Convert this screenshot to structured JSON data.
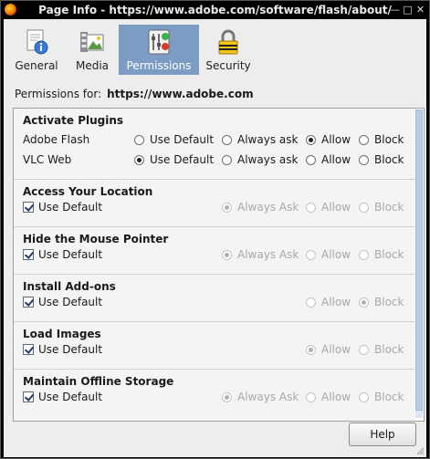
{
  "window": {
    "title": "Page Info - https://www.adobe.com/software/flash/about/"
  },
  "tabs": [
    {
      "label": "General",
      "icon": "general-page-icon"
    },
    {
      "label": "Media",
      "icon": "media-icon"
    },
    {
      "label": "Permissions",
      "icon": "permissions-icon",
      "active": true
    },
    {
      "label": "Security",
      "icon": "padlock-icon"
    }
  ],
  "permissions_for": {
    "label": "Permissions for:",
    "host": "https://www.adobe.com"
  },
  "sections": {
    "plugins": {
      "title": "Activate Plugins",
      "rows": [
        {
          "label": "Adobe Flash",
          "selected": "Allow"
        },
        {
          "label": "VLC Web",
          "selected": "Use Default"
        }
      ],
      "options": [
        "Use Default",
        "Always ask",
        "Allow",
        "Block"
      ]
    },
    "location": {
      "title": "Access Your Location",
      "use_default": "Use Default",
      "options": [
        "Always Ask",
        "Allow",
        "Block"
      ],
      "selected": "Always Ask"
    },
    "pointer": {
      "title": "Hide the Mouse Pointer",
      "use_default": "Use Default",
      "options": [
        "Always Ask",
        "Allow",
        "Block"
      ],
      "selected": "Always Ask"
    },
    "addons": {
      "title": "Install Add-ons",
      "use_default": "Use Default",
      "options": [
        "Allow",
        "Block"
      ],
      "selected": "Block"
    },
    "images": {
      "title": "Load Images",
      "use_default": "Use Default",
      "options": [
        "Allow",
        "Block"
      ],
      "selected": "Allow"
    },
    "storage": {
      "title": "Maintain Offline Storage",
      "use_default": "Use Default",
      "options": [
        "Always Ask",
        "Allow",
        "Block"
      ],
      "selected": "Always Ask"
    }
  },
  "buttons": {
    "help": "Help"
  },
  "colors": {
    "active_tab": "#7d9cc4",
    "titlebar": "#000000",
    "panel_section": "#f4f4f4"
  }
}
